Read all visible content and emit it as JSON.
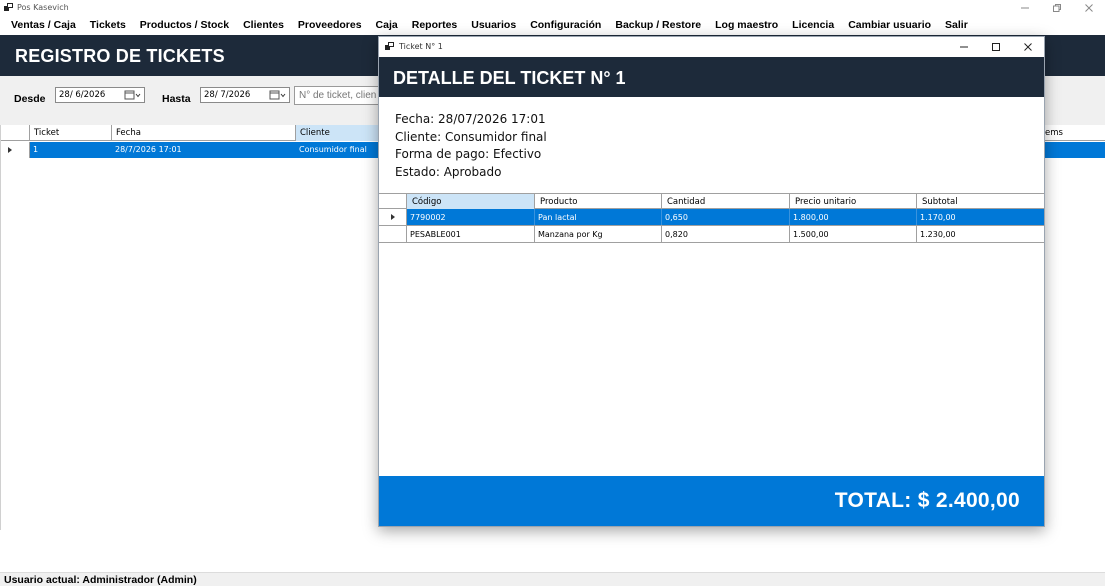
{
  "app": {
    "title": "Pos Kasevich"
  },
  "menu": [
    "Ventas / Caja",
    "Tickets",
    "Productos / Stock",
    "Clientes",
    "Proveedores",
    "Caja",
    "Reportes",
    "Usuarios",
    "Configuración",
    "Backup / Restore",
    "Log maestro",
    "Licencia",
    "Cambiar usuario",
    "Salir"
  ],
  "page": {
    "title": "REGISTRO DE TICKETS"
  },
  "filters": {
    "desde_label": "Desde",
    "desde_value": "28/  6/2026",
    "hasta_label": "Hasta",
    "hasta_value": "28/  7/2026",
    "search_placeholder": "N° de ticket, clien"
  },
  "tickets_table": {
    "columns": [
      "Ticket",
      "Fecha",
      "Cliente",
      "ems"
    ],
    "rows": [
      {
        "ticket": "1",
        "fecha": "28/7/2026 17:01",
        "cliente": "Consumidor final"
      }
    ]
  },
  "status": {
    "text": "Usuario actual: Administrador (Admin)"
  },
  "dialog": {
    "title": "Ticket N° 1",
    "heading": "DETALLE DEL TICKET N° 1",
    "info": {
      "fecha": "Fecha: 28/07/2026 17:01",
      "cliente": "Cliente: Consumidor final",
      "forma_pago": "Forma de pago: Efectivo",
      "estado": "Estado: Aprobado"
    },
    "columns": [
      "Código",
      "Producto",
      "Cantidad",
      "Precio unitario",
      "Subtotal"
    ],
    "rows": [
      [
        "7790002",
        "Pan lactal",
        "0,650",
        "1.800,00",
        "1.170,00"
      ],
      [
        "PESABLE001",
        "Manzana por Kg",
        "0,820",
        "1.500,00",
        "1.230,00"
      ]
    ],
    "total": "TOTAL: $ 2.400,00"
  },
  "colors": {
    "header": "#1d2a3a",
    "accent": "#0078d7",
    "selected_header": "#cce4f7"
  },
  "icons": {
    "app": "window-icon",
    "minimize": "minimize-icon",
    "maximize": "maximize-icon",
    "close": "close-icon",
    "calendar": "calendar-icon",
    "row": "row-arrow-icon"
  }
}
